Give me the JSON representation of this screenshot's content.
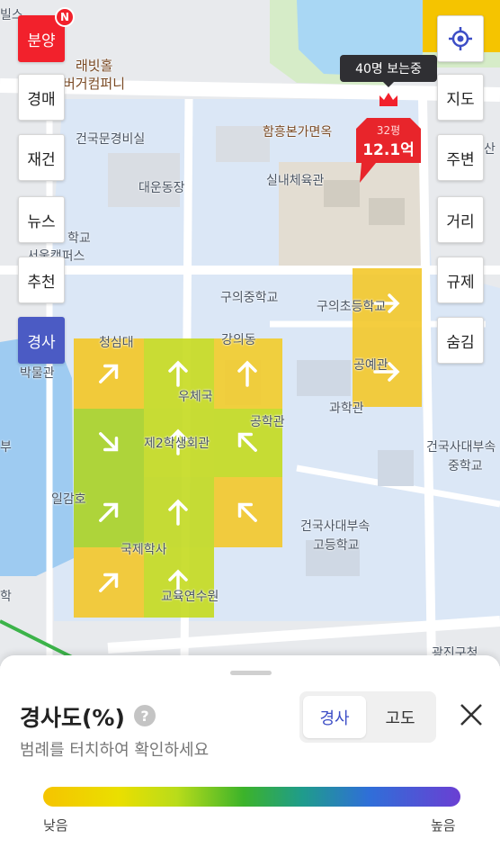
{
  "map": {
    "labels": [
      {
        "id": "map-label-rabbit-hall",
        "text": "래빗홀",
        "cls": "brown"
      },
      {
        "id": "map-label-burger",
        "text": "버거컴퍼니",
        "cls": "brown"
      },
      {
        "id": "map-label-cafeteria",
        "text": "건국문경비실",
        "cls": ""
      },
      {
        "id": "map-label-naengmyeon",
        "text": "함흥본가면옥",
        "cls": "brown"
      },
      {
        "id": "map-label-daeun",
        "text": "대운동장",
        "cls": ""
      },
      {
        "id": "map-label-gym",
        "text": "실내체육관",
        "cls": ""
      },
      {
        "id": "map-label-school1",
        "text": "학교",
        "cls": ""
      },
      {
        "id": "map-label-seoul-campus",
        "text": "서울캠퍼스",
        "cls": ""
      },
      {
        "id": "map-label-guui-middle",
        "text": "구의중학교",
        "cls": ""
      },
      {
        "id": "map-label-guui-elem",
        "text": "구의초등학교",
        "cls": ""
      },
      {
        "id": "map-label-cheongsim",
        "text": "청심대",
        "cls": ""
      },
      {
        "id": "map-label-gangui",
        "text": "강의동",
        "cls": ""
      },
      {
        "id": "map-label-museum",
        "text": "박물관",
        "cls": ""
      },
      {
        "id": "map-label-post",
        "text": "우체국",
        "cls": ""
      },
      {
        "id": "map-label-craft",
        "text": "공예관",
        "cls": ""
      },
      {
        "id": "map-label-science",
        "text": "과학관",
        "cls": ""
      },
      {
        "id": "map-label-engineering",
        "text": "공학관",
        "cls": ""
      },
      {
        "id": "map-label-student-hall",
        "text": "제2학생회관",
        "cls": ""
      },
      {
        "id": "map-label-kuhs-middle1",
        "text": "건국사대부속",
        "cls": ""
      },
      {
        "id": "map-label-kuhs-middle2",
        "text": "중학교",
        "cls": ""
      },
      {
        "id": "map-label-ilgam",
        "text": "일감호",
        "cls": ""
      },
      {
        "id": "map-label-kuhs-high1",
        "text": "건국사대부속",
        "cls": ""
      },
      {
        "id": "map-label-kuhs-high2",
        "text": "고등학교",
        "cls": ""
      },
      {
        "id": "map-label-intl-school",
        "text": "국제학사",
        "cls": ""
      },
      {
        "id": "map-label-education",
        "text": "교육연수원",
        "cls": ""
      },
      {
        "id": "map-label-gwangjin",
        "text": "광진구청",
        "cls": ""
      },
      {
        "id": "map-label-edge-top",
        "text": "빌스",
        "cls": ""
      },
      {
        "id": "map-label-edge-mid",
        "text": "부",
        "cls": ""
      },
      {
        "id": "map-label-edge-low",
        "text": "학",
        "cls": ""
      },
      {
        "id": "map-label-station",
        "text": "산",
        "cls": ""
      }
    ]
  },
  "left_buttons": [
    {
      "id": "btn-presale",
      "label": "분양",
      "style": "red",
      "active": false
    },
    {
      "id": "btn-auction",
      "label": "경매",
      "style": "",
      "active": false
    },
    {
      "id": "btn-rebuild",
      "label": "재건",
      "style": "",
      "active": false
    },
    {
      "id": "btn-news",
      "label": "뉴스",
      "style": "",
      "active": false
    },
    {
      "id": "btn-recommend",
      "label": "추천",
      "style": "",
      "active": false
    },
    {
      "id": "btn-slope",
      "label": "경사",
      "style": "blue",
      "active": true
    }
  ],
  "badge": "N",
  "right_buttons": [
    {
      "id": "btn-map",
      "label": "지도"
    },
    {
      "id": "btn-nearby",
      "label": "주변"
    },
    {
      "id": "btn-distance",
      "label": "거리"
    },
    {
      "id": "btn-regulation",
      "label": "규제"
    },
    {
      "id": "btn-hide",
      "label": "숨김"
    }
  ],
  "viewers": "40명 보는중",
  "price_marker": {
    "size": "32평",
    "price": "12.1억"
  },
  "panel": {
    "title": "경사도(%)",
    "subtitle": "범례를 터치하여 확인하세요",
    "toggle": [
      "경사",
      "고도"
    ],
    "legend_low": "낮음",
    "legend_high": "높음"
  },
  "colors": {
    "accent_blue": "#3d4ec6",
    "red": "#f2212c",
    "slope_yellow": "#f5c400",
    "slope_lime": "#b8d81a"
  }
}
